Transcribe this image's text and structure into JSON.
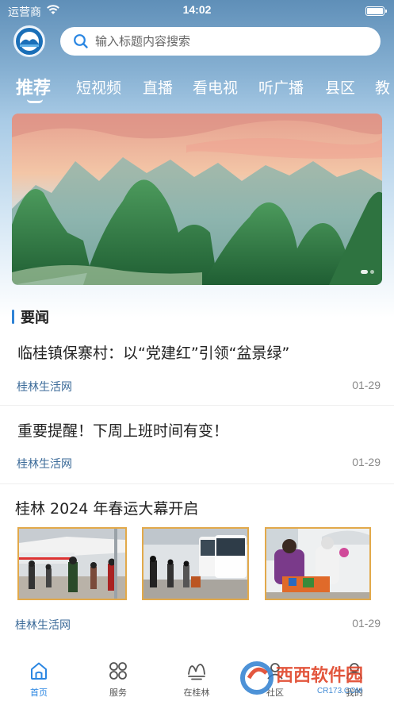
{
  "status_bar": {
    "carrier": "运营商",
    "time": "14:02"
  },
  "search": {
    "placeholder": "输入标题内容搜索"
  },
  "tabs": [
    {
      "label": "推荐",
      "active": true
    },
    {
      "label": "短视频"
    },
    {
      "label": "直播"
    },
    {
      "label": "看电视"
    },
    {
      "label": "听广播"
    },
    {
      "label": "县区"
    },
    {
      "label": "教"
    }
  ],
  "section": {
    "title": "要闻"
  },
  "news": [
    {
      "title": "临桂镇保寨村：以“党建红”引领“盆景绿”",
      "source": "桂林生活网",
      "date": "01-29"
    },
    {
      "title": "重要提醒！下周上班时间有变！",
      "source": "桂林生活网",
      "date": "01-29"
    },
    {
      "title": "桂林 2024 年春运大幕开启",
      "source": "桂林生活网",
      "date": "01-29"
    }
  ],
  "bottom_nav": [
    {
      "label": "首页",
      "icon": "home-icon",
      "active": true
    },
    {
      "label": "服务",
      "icon": "grid-icon"
    },
    {
      "label": "在桂林",
      "icon": "mountain-icon"
    },
    {
      "label": "社区",
      "icon": "community-icon"
    },
    {
      "label": "我的",
      "icon": "user-icon"
    }
  ],
  "watermark": {
    "text": "西西软件园",
    "sub": "CR173.COM"
  },
  "colors": {
    "accent": "#2a86e2",
    "source_text": "#3c6b99",
    "thumb_border": "#e2a94a"
  }
}
